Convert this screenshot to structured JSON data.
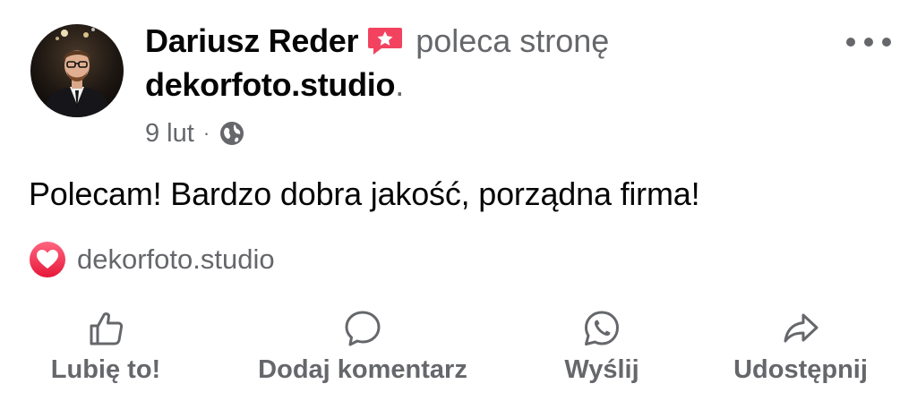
{
  "post": {
    "author_name": "Dariusz Reder",
    "recommend_text": "poleca stronę",
    "page_name": "dekorfoto.studio",
    "page_suffix": ".",
    "date": "9 lut",
    "separator": "·",
    "privacy_icon": "globe-icon",
    "more_icon": "more-options-icon",
    "body_text": "Polecam! Bardzo dobra jakość, porządna firma!"
  },
  "reactions": {
    "icon": "love-reaction-icon",
    "text": "dekorfoto.studio",
    "color": "#f33e58"
  },
  "actions": [
    {
      "label": "Lubię to!",
      "icon": "like-icon"
    },
    {
      "label": "Dodaj komentarz",
      "icon": "comment-icon"
    },
    {
      "label": "Wyślij",
      "icon": "whatsapp-icon"
    },
    {
      "label": "Udostępnij",
      "icon": "share-icon"
    }
  ],
  "colors": {
    "text_primary": "#050505",
    "text_secondary": "#65676b",
    "recommend_badge": "#f3425f"
  }
}
